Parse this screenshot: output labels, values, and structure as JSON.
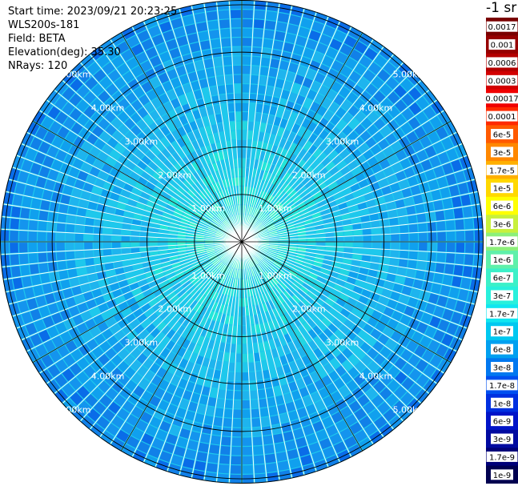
{
  "header": {
    "start_time": "Start time: 2023/09/21 20:23:25",
    "instrument": "WLS200s-181",
    "field": "Field: BETA",
    "elevation": "Elevation(deg): 35.30",
    "nrays": "NRays: 120"
  },
  "chart_data": {
    "type": "heatmap",
    "projection": "polar-ppi",
    "n_rays": 120,
    "range_rings_km": [
      1,
      2,
      3,
      4,
      5
    ],
    "ring_labels": [
      "1.00km",
      "2.00km",
      "3.00km",
      "4.00km",
      "5.00km"
    ],
    "max_range_km": 5.1,
    "spoke_angles_deg": [
      0,
      30,
      60,
      90,
      120,
      150,
      180,
      210,
      240,
      270,
      300,
      330
    ],
    "colorbar": {
      "unit_label": "-1 sr",
      "tick_labels": [
        "0.0017",
        "0.001",
        "0.0006",
        "0.0003",
        "0.00017",
        "0.0001",
        "6e-5",
        "3e-5",
        "1.7e-5",
        "1e-5",
        "6e-6",
        "3e-6",
        "1.7e-6",
        "1e-6",
        "6e-7",
        "3e-7",
        "1.7e-7",
        "1e-7",
        "6e-8",
        "3e-8",
        "1.7e-8",
        "1e-8",
        "6e-9",
        "3e-9",
        "1.7e-9",
        "1e-9"
      ],
      "colors": [
        "#7a0000",
        "#960000",
        "#b40000",
        "#d20000",
        "#f00000",
        "#ff2a00",
        "#ff5a00",
        "#ff8800",
        "#ffb000",
        "#ffd800",
        "#ffff00",
        "#c8f03c",
        "#8cf07a",
        "#5ff0aa",
        "#3cf0c8",
        "#28f0dc",
        "#10e6f0",
        "#00c8f0",
        "#00a0f0",
        "#0078f0",
        "#0050f0",
        "#0030e0",
        "#0014c8",
        "#000aa0",
        "#000078",
        "#000050"
      ]
    },
    "data_colors": {
      "near": "#22e6d8",
      "mid": "#1ec8ec",
      "far": "#10a0ee",
      "outer": "#1180e8"
    }
  }
}
